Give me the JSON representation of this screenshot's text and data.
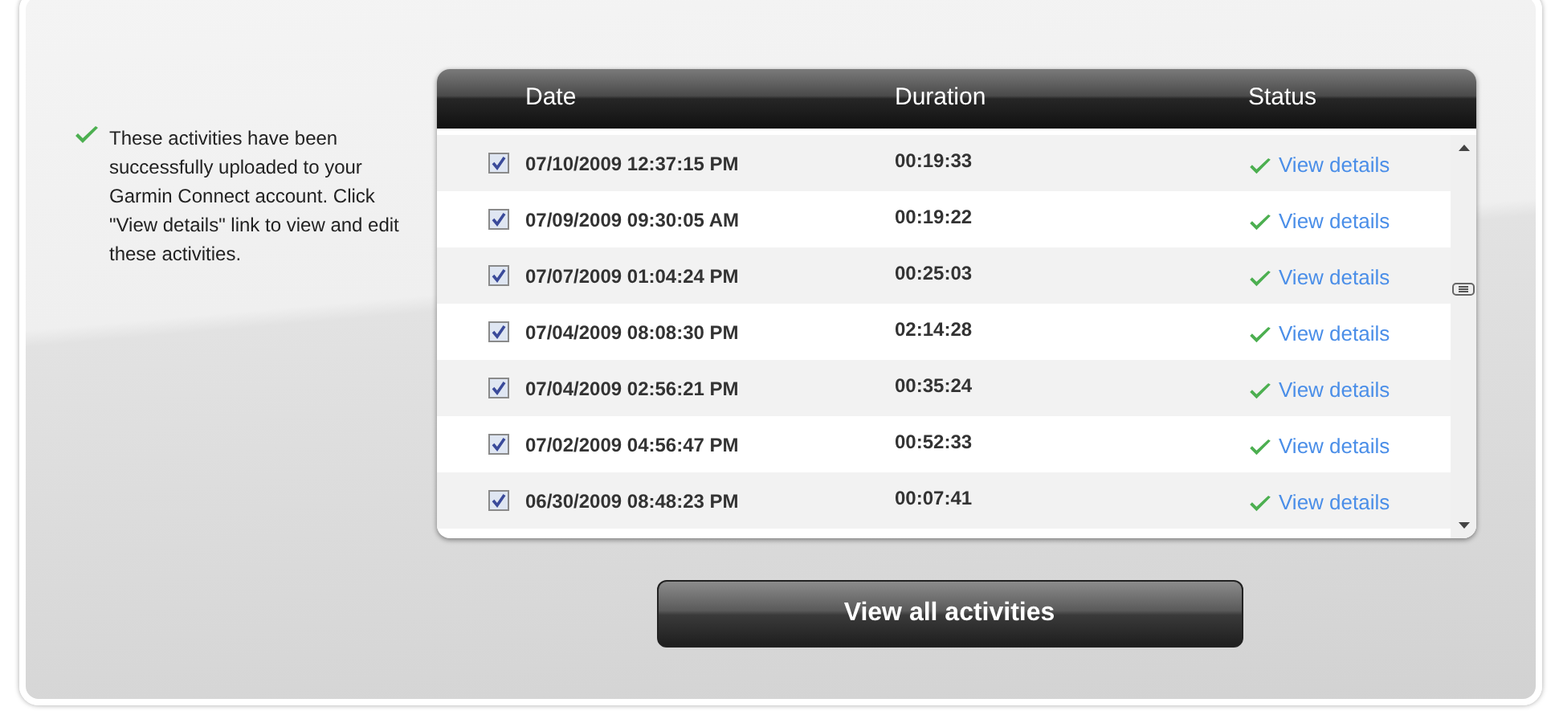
{
  "message": "These activities have been successfully uploaded to your Garmin Connect account. Click \"View details\" link to view and edit these activities.",
  "table": {
    "columns": [
      "Date",
      "Duration",
      "Status"
    ],
    "rows": [
      {
        "checked": true,
        "date": "07/10/2009 12:37:15 PM",
        "duration": "00:19:33",
        "status": "View details"
      },
      {
        "checked": true,
        "date": "07/09/2009 09:30:05 AM",
        "duration": "00:19:22",
        "status": "View details"
      },
      {
        "checked": true,
        "date": "07/07/2009 01:04:24 PM",
        "duration": "00:25:03",
        "status": "View details"
      },
      {
        "checked": true,
        "date": "07/04/2009 08:08:30 PM",
        "duration": "02:14:28",
        "status": "View details"
      },
      {
        "checked": true,
        "date": "07/04/2009 02:56:21 PM",
        "duration": "00:35:24",
        "status": "View details"
      },
      {
        "checked": true,
        "date": "07/02/2009 04:56:47 PM",
        "duration": "00:52:33",
        "status": "View details"
      },
      {
        "checked": true,
        "date": "06/30/2009 08:48:23 PM",
        "duration": "00:07:41",
        "status": "View details"
      }
    ]
  },
  "button": "View all activities"
}
